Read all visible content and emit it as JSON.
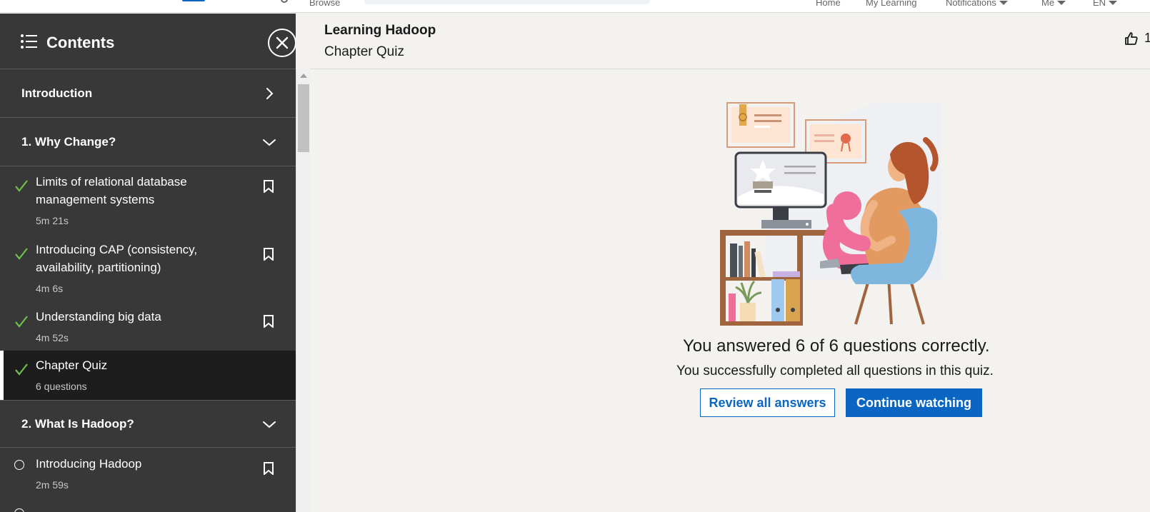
{
  "topnav": {
    "browse_label": "Browse",
    "home_label": "Home",
    "my_learning_label": "My Learning",
    "notifications_label": "Notifications",
    "me_label": "Me",
    "language_label": "EN"
  },
  "sidebar": {
    "title": "Contents",
    "sections": [
      {
        "label": "Introduction",
        "state": "collapsed"
      },
      {
        "label": "1. Why Change?",
        "state": "expanded"
      },
      {
        "label": "2. What Is Hadoop?",
        "state": "expanded"
      }
    ],
    "items": [
      {
        "title": "Limits of relational database management systems",
        "meta": "5m 21s",
        "status": "completed"
      },
      {
        "title": "Introducing CAP (consistency, availability, partitioning)",
        "meta": "4m 6s",
        "status": "completed"
      },
      {
        "title": "Understanding big data",
        "meta": "4m 52s",
        "status": "completed"
      },
      {
        "title": "Chapter Quiz",
        "meta": "6 questions",
        "status": "completed",
        "active": true
      },
      {
        "title": "Introducing Hadoop",
        "meta": "2m 59s",
        "status": "not-started"
      }
    ]
  },
  "header": {
    "course_title": "Learning Hadoop",
    "subtitle": "Chapter Quiz",
    "like_count": "1"
  },
  "quiz_result": {
    "headline": "You answered 6 of 6 questions correctly.",
    "description": "You successfully completed all questions in this quiz.",
    "review_label": "Review all answers",
    "continue_label": "Continue watching"
  },
  "colors": {
    "accent": "#0a66c2",
    "sidebar_bg": "#383838",
    "sidebar_active_bg": "#1d1d1d",
    "check_green": "#6cc04a"
  }
}
